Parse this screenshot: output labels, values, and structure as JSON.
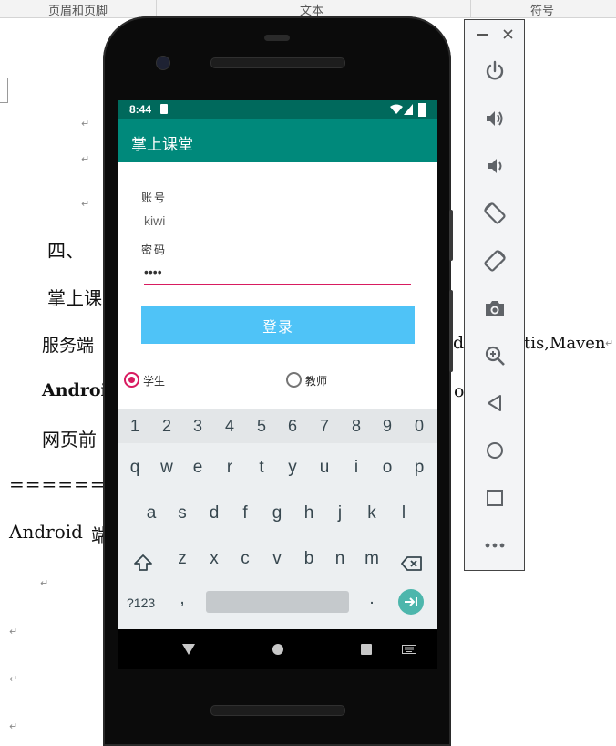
{
  "word": {
    "ribbon_groups": [
      "页眉和页脚",
      "文本",
      "符号"
    ],
    "lines": {
      "l1": "四、",
      "l2": "掌上课",
      "l3a": "服务端",
      "l3b": "d",
      "l3c": "tis,Maven",
      "l4a": "Androi",
      "l4b": "o",
      "l5": "网页前",
      "l6": "========",
      "l7a": "Android",
      "l7b": "端"
    },
    "para_mark": "↵"
  },
  "phone": {
    "status": {
      "time": "8:44"
    },
    "app_title": "掌上课堂",
    "account_label": "账号",
    "account_value": "kiwi",
    "password_label": "密码",
    "password_value": "••••",
    "login_button": "登录",
    "role_options": [
      {
        "label": "学生",
        "checked": true
      },
      {
        "label": "教师",
        "checked": false
      }
    ],
    "keyboard": {
      "numbers": [
        "1",
        "2",
        "3",
        "4",
        "5",
        "6",
        "7",
        "8",
        "9",
        "0"
      ],
      "row1": [
        "q",
        "w",
        "e",
        "r",
        "t",
        "y",
        "u",
        "i",
        "o",
        "p"
      ],
      "row2": [
        "a",
        "s",
        "d",
        "f",
        "g",
        "h",
        "j",
        "k",
        "l"
      ],
      "row3": [
        "z",
        "x",
        "c",
        "v",
        "b",
        "n",
        "m"
      ],
      "symbols_key": "?123",
      "comma_key": ",",
      "period_key": "."
    }
  },
  "colors": {
    "status_bar": "#00695c",
    "app_bar": "#00897b",
    "login_button": "#4fc3f7",
    "accent": "#d81b60",
    "enter_key": "#4db6ac"
  },
  "emulator_toolbar": {
    "window_controls": [
      "minimize-icon",
      "close-icon"
    ],
    "tools": [
      "power-icon",
      "volume-up-icon",
      "volume-down-icon",
      "rotate-left-icon",
      "rotate-right-icon",
      "camera-icon",
      "zoom-icon",
      "back-icon",
      "home-icon",
      "overview-icon",
      "more-icon"
    ]
  }
}
